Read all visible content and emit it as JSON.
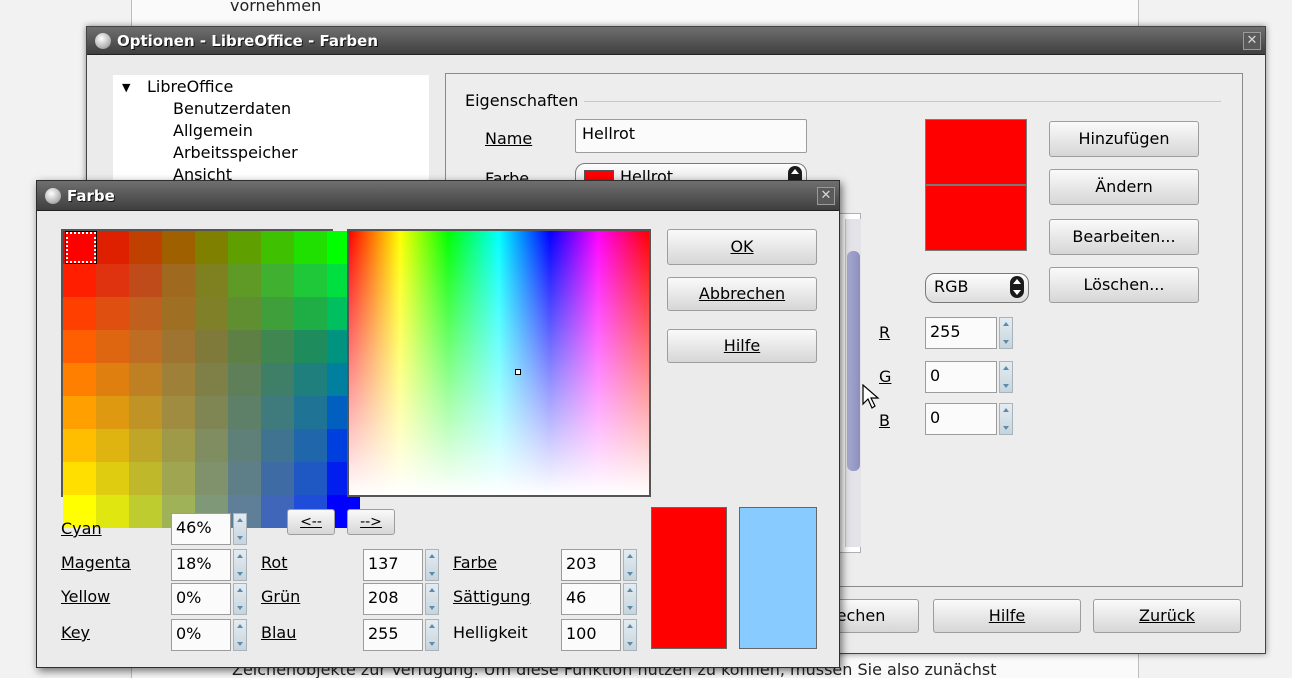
{
  "background_doc": {
    "top_text": "vornehmen",
    "bottom_text": "Zeichenobjekte zur Verfügung. Um diese Funktion nutzen zu können, müssen Sie also zunächst"
  },
  "options_window": {
    "title": "Optionen - LibreOffice - Farben",
    "tree": {
      "root": "LibreOffice",
      "items": [
        "Benutzerdaten",
        "Allgemein",
        "Arbeitsspeicher",
        "Ansicht"
      ]
    },
    "group_title": "Eigenschaften",
    "name_label": "Name",
    "name_value": "Hellrot",
    "farbe_label": "Farbe",
    "farbe_value": "Hellrot",
    "buttons": {
      "hinzufuegen": "Hinzufügen",
      "aendern": "Ändern",
      "bearbeiten": "Bearbeiten...",
      "loeschen": "Löschen..."
    },
    "color_model": "RGB",
    "r_label": "R",
    "r_value": "255",
    "g_label": "G",
    "g_value": "0",
    "b_label": "B",
    "b_value": "0",
    "bottom_buttons": {
      "abbrechen_partial": "echen",
      "hilfe": "Hilfe",
      "zurueck": "Zurück"
    },
    "swatch_color": "#ff0000"
  },
  "farbe_dialog": {
    "title": "Farbe",
    "buttons": {
      "ok": "OK",
      "abbrechen": "Abbrechen",
      "hilfe": "Hilfe",
      "left_arrow": "<--",
      "right_arrow": "-->"
    },
    "cmyk": {
      "cyan_label": "Cyan",
      "cyan_value": "46%",
      "magenta_label": "Magenta",
      "magenta_value": "18%",
      "yellow_label": "Yellow",
      "yellow_value": "0%",
      "key_label": "Key",
      "key_value": "0%"
    },
    "rgb": {
      "rot_label": "Rot",
      "rot_value": "137",
      "gruen_label": "Grün",
      "gruen_value": "208",
      "blau_label": "Blau",
      "blau_value": "255"
    },
    "hsb": {
      "farbe_label": "Farbe",
      "farbe_value": "203",
      "saettigung_label": "Sättigung",
      "saettigung_value": "46",
      "helligkeit_label": "Helligkeit",
      "helligkeit_value": "100"
    },
    "preview": {
      "original_color": "#ff0000",
      "new_color": "#88ccff"
    },
    "palette": [
      [
        "#ff0000",
        "#df2000",
        "#bf4000",
        "#9f6000",
        "#7f8000",
        "#5fa000",
        "#3fc000",
        "#1fe000",
        "#00ff00"
      ],
      [
        "#ff1f00",
        "#df3310",
        "#bf4a1a",
        "#9f6a20",
        "#7f8020",
        "#5f9a26",
        "#3fb030",
        "#1fc838",
        "#00df40"
      ],
      [
        "#ff3f00",
        "#df4f10",
        "#bf601e",
        "#9f7024",
        "#7f8028",
        "#5f8f30",
        "#3f9f3a",
        "#1fae46",
        "#00bf5f"
      ],
      [
        "#ff5f00",
        "#df6610",
        "#bf6d22",
        "#9f7430",
        "#7f7a3a",
        "#5f8044",
        "#3f8650",
        "#1f8c5e",
        "#00937f"
      ],
      [
        "#ff7f00",
        "#df7f10",
        "#bf8024",
        "#9f8038",
        "#7f7f48",
        "#5f7f58",
        "#3f7f68",
        "#1f7f7c",
        "#007f9f"
      ],
      [
        "#ff9f00",
        "#df9910",
        "#bf9326",
        "#9f8c40",
        "#7f8654",
        "#5f8068",
        "#3f7a7c",
        "#1f7394",
        "#005fbf"
      ],
      [
        "#ffbf00",
        "#dfb310",
        "#bfa628",
        "#9f9a48",
        "#7f8d60",
        "#5f8078",
        "#3f7390",
        "#1f67aa",
        "#003fdf"
      ],
      [
        "#ffdf00",
        "#dfcc10",
        "#bfb82a",
        "#9fa550",
        "#7f926c",
        "#5f7f88",
        "#3f6ba4",
        "#1f58c2",
        "#001fef"
      ],
      [
        "#ffff00",
        "#dfe610",
        "#bfcc30",
        "#9fb258",
        "#7f9878",
        "#5f7f98",
        "#3f66b8",
        "#1f4cd8",
        "#0000ff"
      ]
    ]
  }
}
